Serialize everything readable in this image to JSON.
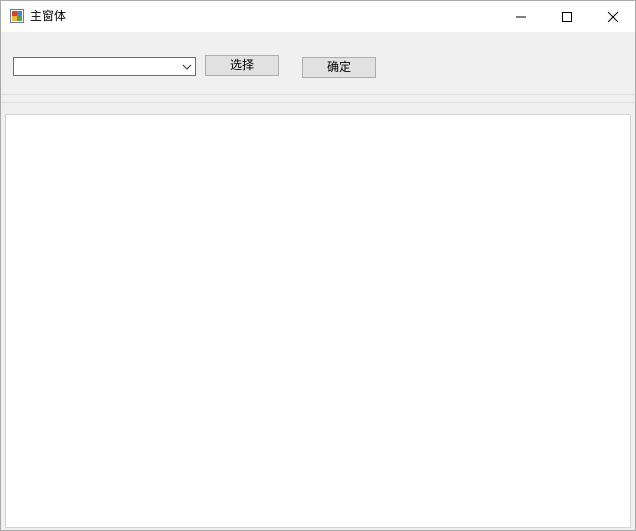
{
  "window": {
    "title": "主窗体",
    "icon": "app-window-icon"
  },
  "caption_buttons": {
    "minimize": "minimize-icon",
    "maximize": "maximize-icon",
    "close": "close-icon"
  },
  "toolbar": {
    "combo_value": "",
    "combo_arrow_icon": "chevron-down-icon",
    "select_label": "选择",
    "ok_label": "确定"
  },
  "colors": {
    "combo_focus_border": "#2f7bc9",
    "button_face": "#e1e1e1",
    "form_background": "#f0f0f0"
  }
}
